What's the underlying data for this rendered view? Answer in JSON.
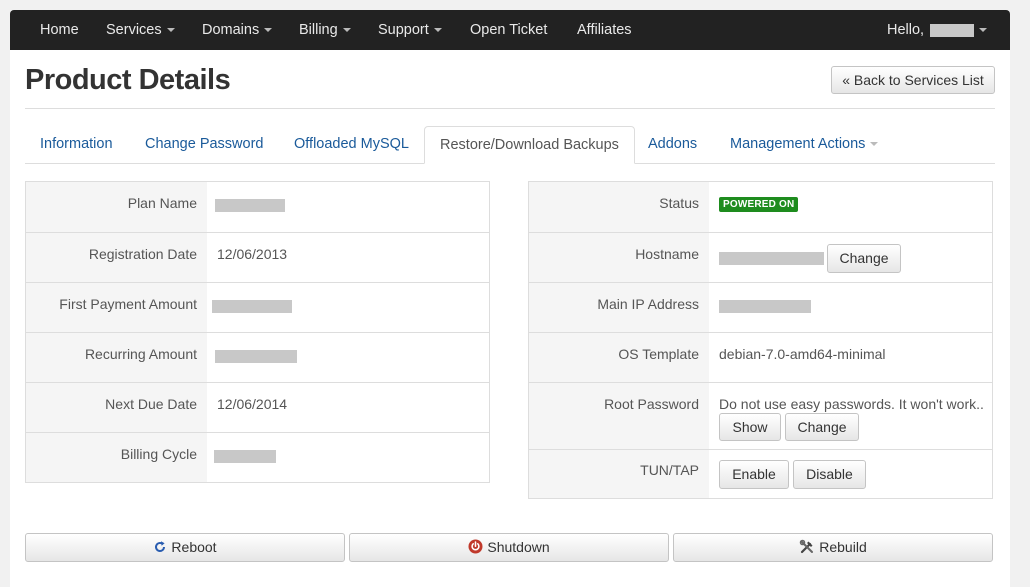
{
  "nav": {
    "items": [
      {
        "label": "Home",
        "dropdown": false
      },
      {
        "label": "Services",
        "dropdown": true
      },
      {
        "label": "Domains",
        "dropdown": true
      },
      {
        "label": "Billing",
        "dropdown": true
      },
      {
        "label": "Support",
        "dropdown": true
      },
      {
        "label": "Open Ticket",
        "dropdown": false
      },
      {
        "label": "Affiliates",
        "dropdown": false
      }
    ],
    "greeting": "Hello,"
  },
  "page": {
    "title": "Product Details",
    "back_label": "« Back to Services List"
  },
  "tabs": [
    {
      "label": "Information"
    },
    {
      "label": "Change Password"
    },
    {
      "label": "Offloaded MySQL"
    },
    {
      "label": "Restore/Download Backups",
      "active": true
    },
    {
      "label": "Addons"
    },
    {
      "label": "Management Actions",
      "dropdown": true
    }
  ],
  "billing": {
    "plan_name_label": "Plan Name",
    "registration_date_label": "Registration Date",
    "registration_date": "12/06/2013",
    "first_payment_label": "First Payment Amount",
    "recurring_label": "Recurring Amount",
    "next_due_label": "Next Due Date",
    "next_due_date": "12/06/2014",
    "billing_cycle_label": "Billing Cycle"
  },
  "server": {
    "status_label": "Status",
    "status_value": "POWERED ON",
    "status_color": "#1e8c1e",
    "hostname_label": "Hostname",
    "hostname_change": "Change",
    "main_ip_label": "Main IP Address",
    "os_template_label": "OS Template",
    "os_template": "debian-7.0-amd64-minimal",
    "root_password_label": "Root Password",
    "root_password_hint": "Do not use easy passwords. It won't work..",
    "show_label": "Show",
    "password_change": "Change",
    "tuntap_label": "TUN/TAP",
    "enable_label": "Enable",
    "disable_label": "Disable"
  },
  "actions": {
    "reboot": {
      "label": "Reboot",
      "icon": "reboot-icon",
      "color": "#2a5db0"
    },
    "shutdown": {
      "label": "Shutdown",
      "icon": "power-icon",
      "color": "#c0392b"
    },
    "rebuild": {
      "label": "Rebuild",
      "icon": "tools-icon",
      "color": "#444444"
    }
  }
}
